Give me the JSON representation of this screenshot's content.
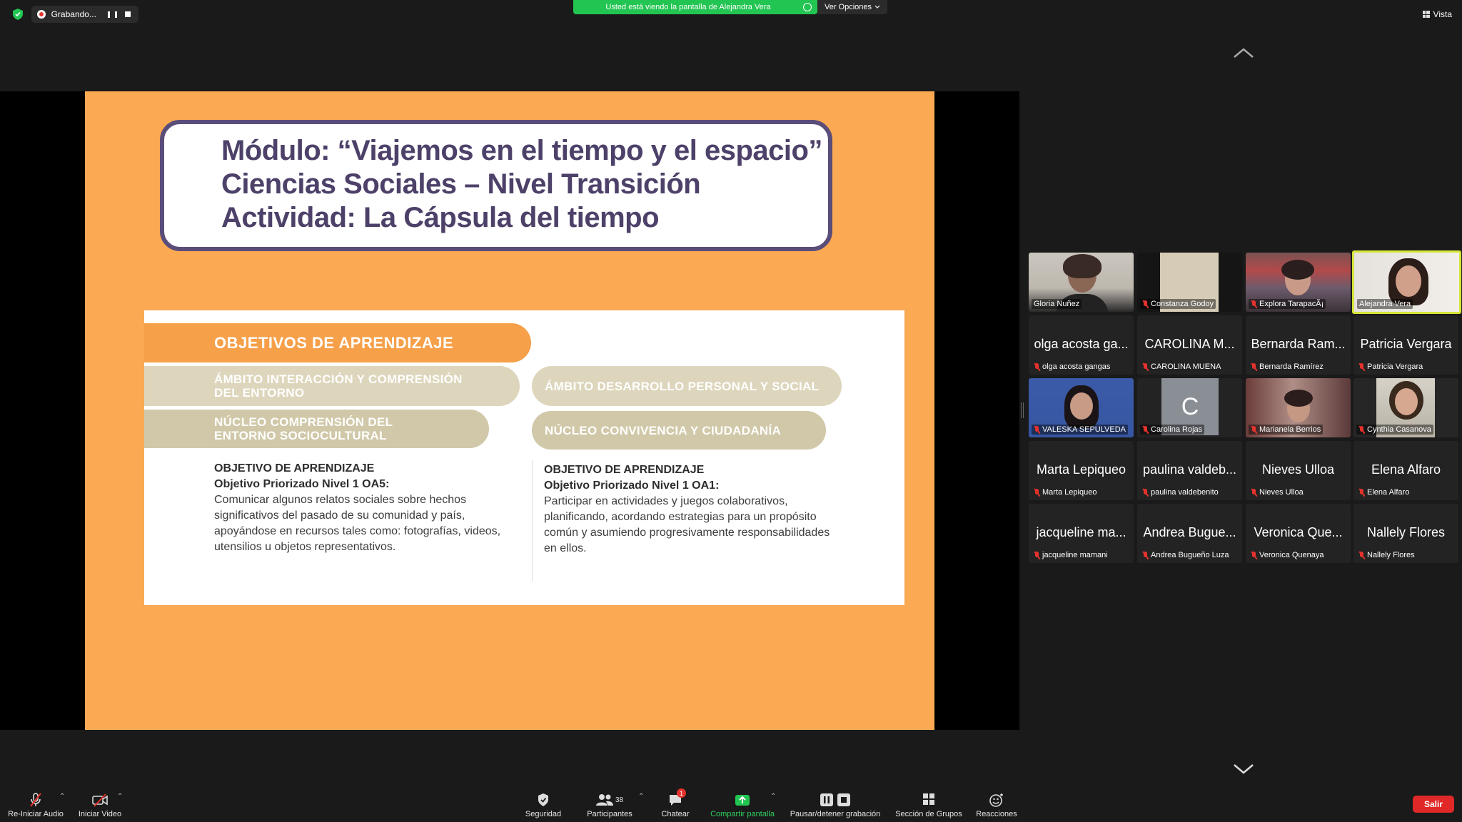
{
  "top": {
    "recording_label": "Grabando...",
    "banner_text": "Usted está viendo la pantalla de Alejandra Vera",
    "view_options": "Ver Opciones",
    "view_button": "Vista"
  },
  "slide": {
    "title_line1": "Módulo: “Viajemos en el tiempo y el espacio”",
    "title_line2": "Ciencias Sociales – Nivel Transición",
    "title_line3": "Actividad: La Cápsula del tiempo",
    "objectives_header": "OBJETIVOS DE APRENDIZAJE",
    "left": {
      "ambito_line1": "ÁMBITO INTERACCIÓN Y COMPRENSIÓN",
      "ambito_line2": "DEL ENTORNO",
      "nucleo_line1": "NÚCLEO COMPRENSIÓN DEL",
      "nucleo_line2": "ENTORNO SOCIOCULTURAL",
      "heading": "OBJETIVO DE APRENDIZAJE",
      "subheading": "Objetivo Priorizado Nivel 1 OA5:",
      "body_line1": "Comunicar algunos relatos sociales sobre hechos",
      "body_line2": "significativos del pasado de su comunidad y país,",
      "body_line3": "apoyándose en recursos tales como: fotografías, videos,",
      "body_line4": "utensilios u objetos representativos."
    },
    "right": {
      "ambito": "ÁMBITO DESARROLLO PERSONAL Y SOCIAL",
      "nucleo": "NÚCLEO CONVIVENCIA Y CIUDADANÍA",
      "heading": "OBJETIVO DE APRENDIZAJE",
      "subheading": "Objetivo Priorizado Nivel 1 OA1:",
      "body_line1": "Participar en actividades y juegos colaborativos,",
      "body_line2": "planificando, acordando estrategias para un propósito",
      "body_line3": "común y asumiendo progresivamente responsabilidades",
      "body_line4": "en ellos."
    }
  },
  "participants": [
    {
      "name": "Gloria Nuñez",
      "video": true,
      "muted": false
    },
    {
      "name": "Constanza Godoy",
      "video": true,
      "muted": true
    },
    {
      "name": "Explora TarapacÃ¡",
      "video": true,
      "muted": true
    },
    {
      "name": "Alejandra Vera",
      "video": true,
      "muted": false,
      "active": true
    },
    {
      "name": "olga acosta gangas",
      "display": "olga acosta ga...",
      "muted": true
    },
    {
      "name": "CAROLINA MUENA",
      "display": "CAROLINA M...",
      "muted": true
    },
    {
      "name": "Bernarda Ramírez",
      "display": "Bernarda Ram...",
      "muted": true
    },
    {
      "name": "Patricia Vergara",
      "display": "Patricia Vergara",
      "muted": true
    },
    {
      "name": "VALESKA SEPULVEDA",
      "video": true,
      "muted": true
    },
    {
      "name": "Carolina Rojas",
      "initial": "C",
      "muted": true
    },
    {
      "name": "Marianela Berrios",
      "video": true,
      "muted": true
    },
    {
      "name": "Cynthia Casanova",
      "video": true,
      "muted": true
    },
    {
      "name": "Marta Lepiqueo",
      "display": "Marta Lepiqueo",
      "muted": true
    },
    {
      "name": "paulina valdebenito",
      "display": "paulina valdeb...",
      "muted": true
    },
    {
      "name": "Nieves Ulloa",
      "display": "Nieves Ulloa",
      "muted": true
    },
    {
      "name": "Elena Alfaro",
      "display": "Elena Alfaro",
      "muted": true
    },
    {
      "name": "jacqueline mamani",
      "display": "jacqueline ma...",
      "muted": true
    },
    {
      "name": "Andrea Bugueño Luza",
      "display": "Andrea Bugue...",
      "muted": true
    },
    {
      "name": "Veronica Quenaya",
      "display": "Veronica Que...",
      "muted": true
    },
    {
      "name": "Nallely Flores",
      "display": "Nallely Flores",
      "muted": true
    }
  ],
  "toolbar": {
    "audio": "Re-Iniciar Audio",
    "video": "Iniciar Video",
    "security": "Seguridad",
    "participants": "Participantes",
    "participants_count": "38",
    "chat": "Chatear",
    "chat_badge": "1",
    "share": "Compartir pantalla",
    "record": "Pausar/detener grabación",
    "groups": "Sección de Grupos",
    "reactions": "Reacciones",
    "leave": "Salir"
  },
  "colors": {
    "banner_green": "#23c552",
    "slide_orange": "#fba952",
    "title_purple": "#4d4169",
    "leave_red": "#e02828"
  }
}
